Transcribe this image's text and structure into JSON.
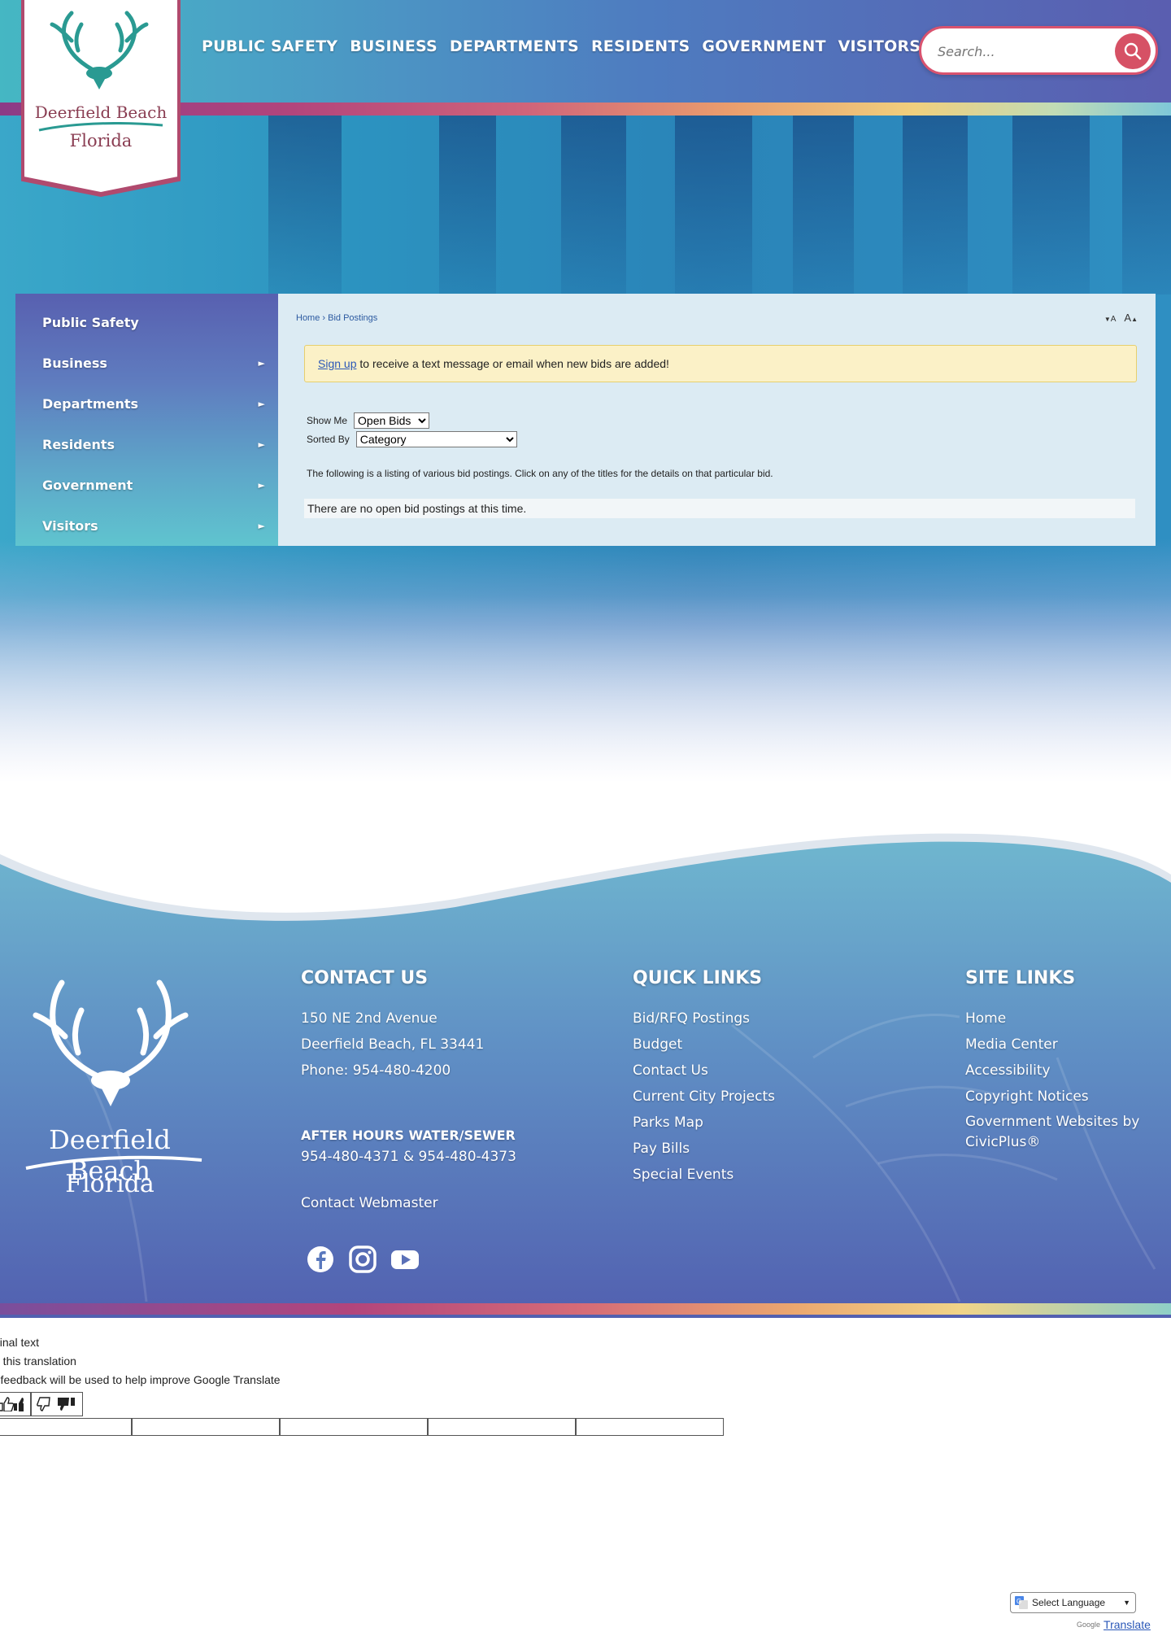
{
  "header": {
    "logo": {
      "name": "Deerfield Beach",
      "sub": "Florida"
    },
    "nav": [
      "PUBLIC SAFETY",
      "BUSINESS",
      "DEPARTMENTS",
      "RESIDENTS",
      "GOVERNMENT",
      "VISITORS"
    ],
    "search_placeholder": "Search..."
  },
  "sidebar": {
    "items": [
      {
        "label": "Public Safety",
        "has_submenu": false
      },
      {
        "label": "Business",
        "has_submenu": true
      },
      {
        "label": "Departments",
        "has_submenu": true
      },
      {
        "label": "Residents",
        "has_submenu": true
      },
      {
        "label": "Government",
        "has_submenu": true
      },
      {
        "label": "Visitors",
        "has_submenu": true
      }
    ],
    "arrow_glyph": "►"
  },
  "content": {
    "breadcrumb": {
      "home": "Home",
      "separator": "›",
      "current": "Bid Postings"
    },
    "font_decrease": "A",
    "font_increase": "A",
    "notice": {
      "link": "Sign up",
      "text": " to receive a text message or email when new bids are added!"
    },
    "show_me": {
      "label": "Show Me",
      "selected": "Open Bids"
    },
    "sorted_by": {
      "label": "Sorted By",
      "selected": "Category"
    },
    "description": "The following is a listing of various bid postings. Click on any of the titles for the details on that particular bid.",
    "empty_message": "There are no open bid postings at this time."
  },
  "footer": {
    "logo": {
      "name": "Deerfield Beach",
      "sub": "Florida"
    },
    "contact": {
      "heading": "CONTACT US",
      "address1": "150 NE 2nd Avenue",
      "address2": "Deerfield Beach, FL 33441",
      "phone": "Phone: 954-480-4200",
      "after_hours_heading": "AFTER HOURS WATER/SEWER",
      "after_hours_phones": "954-480-4371 & 954-480-4373",
      "webmaster": "Contact Webmaster"
    },
    "quick_links": {
      "heading": "QUICK LINKS",
      "items": [
        "Bid/RFQ Postings",
        "Budget",
        "Contact Us",
        "Current City Projects",
        "Parks Map",
        "Pay Bills",
        "Special Events"
      ]
    },
    "site_links": {
      "heading": "SITE LINKS",
      "items": [
        "Home",
        "Media Center",
        "Accessibility",
        "Copyright Notices",
        "Government Websites by CivicPlus®"
      ]
    },
    "social": [
      "facebook-icon",
      "instagram-icon",
      "youtube-icon"
    ]
  },
  "translate": {
    "line1": "ginal text",
    "line2": "e this translation",
    "line3": "r feedback will be used to help improve Google Translate",
    "select_label": "Select Language",
    "powered_by": "Google",
    "translate_link": "Translate"
  },
  "colors": {
    "header_start": "#45b7c3",
    "header_end": "#5a5eb0",
    "brand_red": "#d65165",
    "logo_maroon": "#8a3d52",
    "logo_teal": "#2a9a92",
    "notice_bg": "#fbf1c7",
    "panel_bg": "#dcebf3"
  }
}
